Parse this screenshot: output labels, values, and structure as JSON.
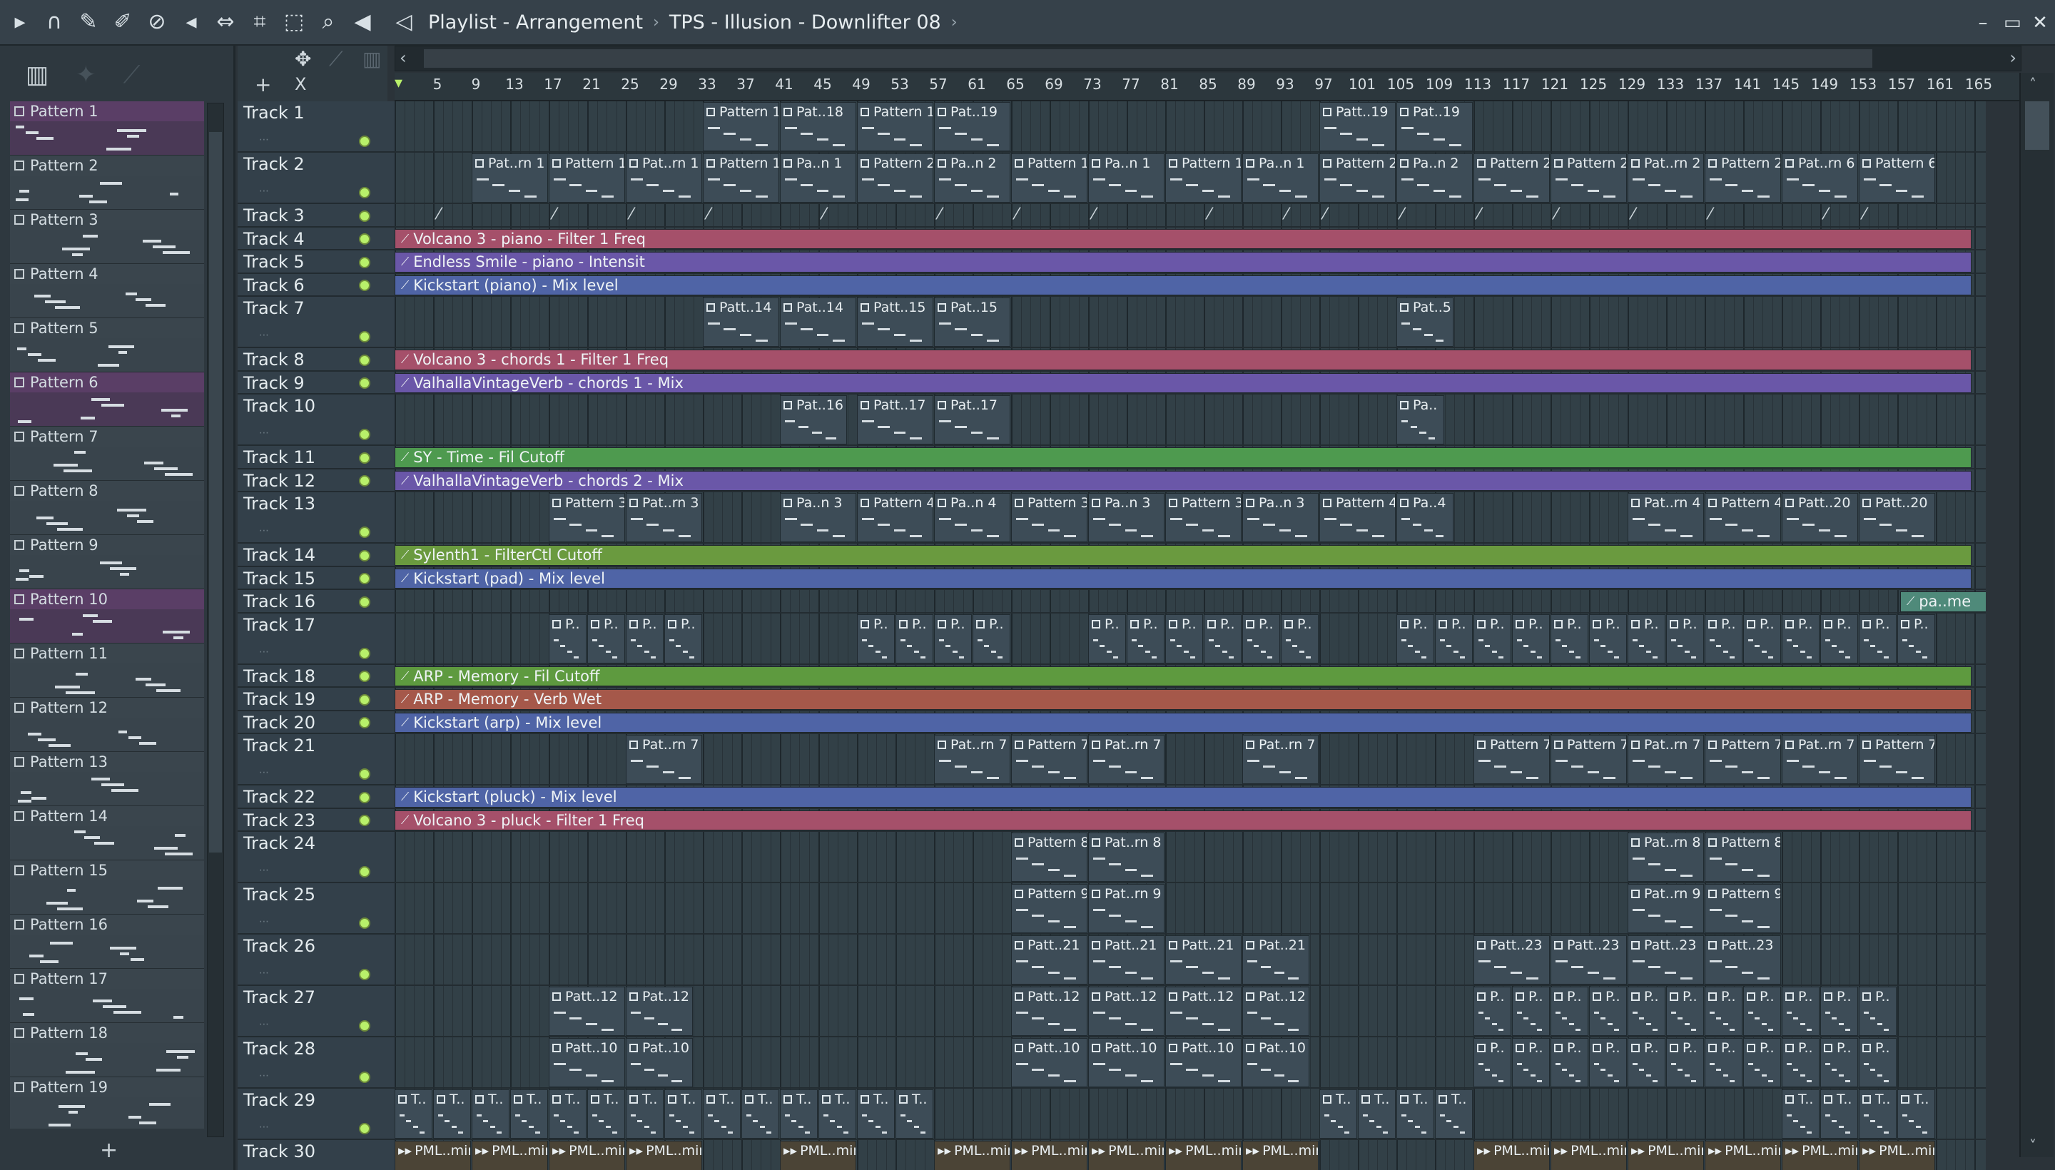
{
  "titlebar": {
    "icons": [
      "play-arrow-icon",
      "magnet-icon",
      "pencil-icon",
      "brush-icon",
      "delete-icon",
      "mute-icon",
      "slip-icon",
      "slice-icon",
      "select-icon",
      "zoom-icon",
      "playback-icon"
    ],
    "window_name": "Playlist - Arrangement",
    "sep1": "›",
    "project": "TPS - Illusion - Downlifter 08",
    "sep2": "›",
    "controls": [
      "minimize-icon",
      "maximize-icon",
      "close-icon"
    ]
  },
  "picker": {
    "tools": [
      "pattern-picker-icon",
      "audio-picker-icon",
      "automation-picker-icon"
    ],
    "add_label": "+",
    "patterns": [
      {
        "label": "Pattern 1",
        "selected": true
      },
      {
        "label": "Pattern 2",
        "selected": false
      },
      {
        "label": "Pattern 3",
        "selected": false
      },
      {
        "label": "Pattern 4",
        "selected": false
      },
      {
        "label": "Pattern 5",
        "selected": false
      },
      {
        "label": "Pattern 6",
        "selected": true
      },
      {
        "label": "Pattern 7",
        "selected": false
      },
      {
        "label": "Pattern 8",
        "selected": false
      },
      {
        "label": "Pattern 9",
        "selected": false
      },
      {
        "label": "Pattern 10",
        "selected": true
      },
      {
        "label": "Pattern 11",
        "selected": false
      },
      {
        "label": "Pattern 12",
        "selected": false
      },
      {
        "label": "Pattern 13",
        "selected": false
      },
      {
        "label": "Pattern 14",
        "selected": false
      },
      {
        "label": "Pattern 15",
        "selected": false
      },
      {
        "label": "Pattern 16",
        "selected": false
      },
      {
        "label": "Pattern 17",
        "selected": false
      },
      {
        "label": "Pattern 18",
        "selected": false
      },
      {
        "label": "Pattern 19",
        "selected": false
      }
    ]
  },
  "toolstrip": {
    "add_track": "+",
    "delete": "X"
  },
  "ruler": {
    "ticks": [
      "5",
      "9",
      "13",
      "17",
      "21",
      "25",
      "29",
      "33",
      "37",
      "41",
      "45",
      "49",
      "53",
      "57",
      "61",
      "65",
      "69",
      "73",
      "77",
      "81",
      "85",
      "89",
      "93",
      "97",
      "101",
      "105",
      "109",
      "113",
      "117",
      "121",
      "125",
      "129",
      "133",
      "137",
      "141",
      "145",
      "149",
      "153",
      "157",
      "161",
      "165"
    ]
  },
  "tracks": [
    {
      "name": "Track 1",
      "tall": true
    },
    {
      "name": "Track 2",
      "tall": true
    },
    {
      "name": "Track 3",
      "tall": false
    },
    {
      "name": "Track 4",
      "tall": false
    },
    {
      "name": "Track 5",
      "tall": false
    },
    {
      "name": "Track 6",
      "tall": false
    },
    {
      "name": "Track 7",
      "tall": true
    },
    {
      "name": "Track 8",
      "tall": false
    },
    {
      "name": "Track 9",
      "tall": false
    },
    {
      "name": "Track 10",
      "tall": true
    },
    {
      "name": "Track 11",
      "tall": false
    },
    {
      "name": "Track 12",
      "tall": false
    },
    {
      "name": "Track 13",
      "tall": true
    },
    {
      "name": "Track 14",
      "tall": false
    },
    {
      "name": "Track 15",
      "tall": false
    },
    {
      "name": "Track 16",
      "tall": false
    },
    {
      "name": "Track 17",
      "tall": true
    },
    {
      "name": "Track 18",
      "tall": false
    },
    {
      "name": "Track 19",
      "tall": false
    },
    {
      "name": "Track 20",
      "tall": false
    },
    {
      "name": "Track 21",
      "tall": true
    },
    {
      "name": "Track 22",
      "tall": false
    },
    {
      "name": "Track 23",
      "tall": false
    },
    {
      "name": "Track 24",
      "tall": true
    },
    {
      "name": "Track 25",
      "tall": true
    },
    {
      "name": "Track 26",
      "tall": true
    },
    {
      "name": "Track 27",
      "tall": true
    },
    {
      "name": "Track 28",
      "tall": true
    },
    {
      "name": "Track 29",
      "tall": true
    },
    {
      "name": "Track 30",
      "tall": true
    }
  ],
  "automation": [
    {
      "track": 3,
      "label": "Volcano 3 - piano - Filter 1 Freq",
      "color": "#a5506a"
    },
    {
      "track": 4,
      "label": "Endless Smile - piano - Intensit",
      "color": "#6a57a8"
    },
    {
      "track": 5,
      "label": "Kickstart (piano) - Mix level",
      "color": "#4f64a6"
    },
    {
      "track": 7,
      "label": "Volcano 3 - chords 1 - Filter 1 Freq",
      "color": "#a5506a"
    },
    {
      "track": 8,
      "label": "ValhallaVintageVerb - chords 1 - Mix",
      "color": "#6a57a8"
    },
    {
      "track": 10,
      "label": "SY - Time - Fil Cutoff",
      "color": "#4e9a4f"
    },
    {
      "track": 11,
      "label": "ValhallaVintageVerb - chords 2 - Mix",
      "color": "#6a57a8"
    },
    {
      "track": 13,
      "label": "Sylenth1 - FilterCtl Cutoff",
      "color": "#6a9a3f"
    },
    {
      "track": 14,
      "label": "Kickstart (pad) - Mix level",
      "color": "#4f64a6"
    },
    {
      "track": 17,
      "label": "ARP - Memory - Fil Cutoff",
      "color": "#5e9a3f"
    },
    {
      "track": 18,
      "label": "ARP - Memory - Verb Wet",
      "color": "#a5584a"
    },
    {
      "track": 19,
      "label": "Kickstart (arp) - Mix level",
      "color": "#4f64a6"
    },
    {
      "track": 21,
      "label": "Kickstart (pluck) - Mix level",
      "color": "#4f64a6"
    },
    {
      "track": 22,
      "label": "Volcano 3 - pluck - Filter 1 Freq",
      "color": "#a5506a"
    }
  ],
  "track16_clip": "pa..me",
  "clips": [
    {
      "track": 0,
      "bar": 33,
      "len": 8,
      "label": "Pattern 1"
    },
    {
      "track": 0,
      "bar": 41,
      "len": 8,
      "label": "Pat..18"
    },
    {
      "track": 0,
      "bar": 49,
      "len": 8,
      "label": "Pattern 1"
    },
    {
      "track": 0,
      "bar": 57,
      "len": 8,
      "label": "Pat..19"
    },
    {
      "track": 0,
      "bar": 97,
      "len": 8,
      "label": "Patt..19"
    },
    {
      "track": 0,
      "bar": 105,
      "len": 8,
      "label": "Pat..19"
    },
    {
      "track": 1,
      "bar": 9,
      "len": 8,
      "label": "Pat..rn 1"
    },
    {
      "track": 1,
      "bar": 17,
      "len": 8,
      "label": "Pattern 1"
    },
    {
      "track": 1,
      "bar": 25,
      "len": 8,
      "label": "Pat..rn 1"
    },
    {
      "track": 1,
      "bar": 33,
      "len": 8,
      "label": "Pattern 1"
    },
    {
      "track": 1,
      "bar": 41,
      "len": 8,
      "label": "Pa..n 1"
    },
    {
      "track": 1,
      "bar": 49,
      "len": 8,
      "label": "Pattern 2"
    },
    {
      "track": 1,
      "bar": 57,
      "len": 8,
      "label": "Pa..n 2"
    },
    {
      "track": 1,
      "bar": 65,
      "len": 8,
      "label": "Pattern 1"
    },
    {
      "track": 1,
      "bar": 73,
      "len": 8,
      "label": "Pa..n 1"
    },
    {
      "track": 1,
      "bar": 81,
      "len": 8,
      "label": "Pattern 1"
    },
    {
      "track": 1,
      "bar": 89,
      "len": 8,
      "label": "Pa..n 1"
    },
    {
      "track": 1,
      "bar": 97,
      "len": 8,
      "label": "Pattern 2"
    },
    {
      "track": 1,
      "bar": 105,
      "len": 8,
      "label": "Pa..n 2"
    },
    {
      "track": 1,
      "bar": 113,
      "len": 8,
      "label": "Pattern 2"
    },
    {
      "track": 1,
      "bar": 121,
      "len": 8,
      "label": "Pattern 2"
    },
    {
      "track": 1,
      "bar": 129,
      "len": 8,
      "label": "Pat..rn 2"
    },
    {
      "track": 1,
      "bar": 137,
      "len": 8,
      "label": "Pattern 2"
    },
    {
      "track": 1,
      "bar": 145,
      "len": 8,
      "label": "Pat..rn 6"
    },
    {
      "track": 1,
      "bar": 153,
      "len": 8,
      "label": "Pattern 6"
    },
    {
      "track": 6,
      "bar": 33,
      "len": 8,
      "label": "Patt..14"
    },
    {
      "track": 6,
      "bar": 41,
      "len": 8,
      "label": "Pat..14"
    },
    {
      "track": 6,
      "bar": 49,
      "len": 8,
      "label": "Patt..15"
    },
    {
      "track": 6,
      "bar": 57,
      "len": 8,
      "label": "Pat..15"
    },
    {
      "track": 6,
      "bar": 105,
      "len": 6,
      "label": "Pat..5"
    },
    {
      "track": 9,
      "bar": 41,
      "len": 7,
      "label": "Pat..16"
    },
    {
      "track": 9,
      "bar": 49,
      "len": 8,
      "label": "Patt..17"
    },
    {
      "track": 9,
      "bar": 57,
      "len": 8,
      "label": "Pat..17"
    },
    {
      "track": 9,
      "bar": 105,
      "len": 5,
      "label": "Pa.."
    },
    {
      "track": 12,
      "bar": 17,
      "len": 8,
      "label": "Pattern 3"
    },
    {
      "track": 12,
      "bar": 25,
      "len": 8,
      "label": "Pat..rn 3"
    },
    {
      "track": 12,
      "bar": 41,
      "len": 8,
      "label": "Pa..n 3"
    },
    {
      "track": 12,
      "bar": 49,
      "len": 8,
      "label": "Pattern 4"
    },
    {
      "track": 12,
      "bar": 57,
      "len": 8,
      "label": "Pa..n 4"
    },
    {
      "track": 12,
      "bar": 65,
      "len": 8,
      "label": "Pattern 3"
    },
    {
      "track": 12,
      "bar": 73,
      "len": 8,
      "label": "Pa..n 3"
    },
    {
      "track": 12,
      "bar": 81,
      "len": 8,
      "label": "Pattern 3"
    },
    {
      "track": 12,
      "bar": 89,
      "len": 8,
      "label": "Pa..n 3"
    },
    {
      "track": 12,
      "bar": 97,
      "len": 8,
      "label": "Pattern 4"
    },
    {
      "track": 12,
      "bar": 105,
      "len": 6,
      "label": "Pa..4"
    },
    {
      "track": 12,
      "bar": 129,
      "len": 8,
      "label": "Pat..rn 4"
    },
    {
      "track": 12,
      "bar": 137,
      "len": 8,
      "label": "Pattern 4"
    },
    {
      "track": 12,
      "bar": 145,
      "len": 8,
      "label": "Patt..20"
    },
    {
      "track": 12,
      "bar": 153,
      "len": 8,
      "label": "Patt..20"
    },
    {
      "track": 20,
      "bar": 25,
      "len": 8,
      "label": "Pat..rn 7"
    },
    {
      "track": 20,
      "bar": 57,
      "len": 8,
      "label": "Pat..rn 7"
    },
    {
      "track": 20,
      "bar": 65,
      "len": 8,
      "label": "Pattern 7"
    },
    {
      "track": 20,
      "bar": 73,
      "len": 8,
      "label": "Pat..rn 7"
    },
    {
      "track": 20,
      "bar": 89,
      "len": 8,
      "label": "Pat..rn 7"
    },
    {
      "track": 20,
      "bar": 113,
      "len": 8,
      "label": "Pattern 7"
    },
    {
      "track": 20,
      "bar": 121,
      "len": 8,
      "label": "Pattern 7"
    },
    {
      "track": 20,
      "bar": 129,
      "len": 8,
      "label": "Pat..rn 7"
    },
    {
      "track": 20,
      "bar": 137,
      "len": 8,
      "label": "Pattern 7"
    },
    {
      "track": 20,
      "bar": 145,
      "len": 8,
      "label": "Pat..rn 7"
    },
    {
      "track": 20,
      "bar": 153,
      "len": 8,
      "label": "Pattern 7"
    },
    {
      "track": 23,
      "bar": 65,
      "len": 8,
      "label": "Pattern 8"
    },
    {
      "track": 23,
      "bar": 73,
      "len": 8,
      "label": "Pat..rn 8"
    },
    {
      "track": 23,
      "bar": 129,
      "len": 8,
      "label": "Pat..rn 8"
    },
    {
      "track": 23,
      "bar": 137,
      "len": 8,
      "label": "Pattern 8"
    },
    {
      "track": 24,
      "bar": 65,
      "len": 8,
      "label": "Pattern 9"
    },
    {
      "track": 24,
      "bar": 73,
      "len": 8,
      "label": "Pat..rn 9"
    },
    {
      "track": 24,
      "bar": 129,
      "len": 8,
      "label": "Pat..rn 9"
    },
    {
      "track": 24,
      "bar": 137,
      "len": 8,
      "label": "Pattern 9"
    },
    {
      "track": 25,
      "bar": 65,
      "len": 8,
      "label": "Patt..21"
    },
    {
      "track": 25,
      "bar": 73,
      "len": 8,
      "label": "Patt..21"
    },
    {
      "track": 25,
      "bar": 81,
      "len": 8,
      "label": "Patt..21"
    },
    {
      "track": 25,
      "bar": 89,
      "len": 7,
      "label": "Pat..21"
    },
    {
      "track": 25,
      "bar": 113,
      "len": 8,
      "label": "Patt..23"
    },
    {
      "track": 25,
      "bar": 121,
      "len": 8,
      "label": "Patt..23"
    },
    {
      "track": 25,
      "bar": 129,
      "len": 8,
      "label": "Patt..23"
    },
    {
      "track": 25,
      "bar": 137,
      "len": 8,
      "label": "Patt..23"
    },
    {
      "track": 26,
      "bar": 17,
      "len": 8,
      "label": "Patt..12"
    },
    {
      "track": 26,
      "bar": 25,
      "len": 7,
      "label": "Pat..12"
    },
    {
      "track": 26,
      "bar": 65,
      "len": 8,
      "label": "Patt..12"
    },
    {
      "track": 26,
      "bar": 73,
      "len": 8,
      "label": "Patt..12"
    },
    {
      "track": 26,
      "bar": 81,
      "len": 8,
      "label": "Patt..12"
    },
    {
      "track": 26,
      "bar": 89,
      "len": 7,
      "label": "Pat..12"
    },
    {
      "track": 27,
      "bar": 17,
      "len": 8,
      "label": "Patt..10"
    },
    {
      "track": 27,
      "bar": 25,
      "len": 7,
      "label": "Pat..10"
    },
    {
      "track": 27,
      "bar": 65,
      "len": 8,
      "label": "Patt..10"
    },
    {
      "track": 27,
      "bar": 73,
      "len": 8,
      "label": "Patt..10"
    },
    {
      "track": 27,
      "bar": 81,
      "len": 8,
      "label": "Patt..10"
    },
    {
      "track": 27,
      "bar": 89,
      "len": 7,
      "label": "Pat..10"
    }
  ],
  "small_clips": [
    {
      "track": 16,
      "bars": [
        17,
        21,
        25,
        29,
        49,
        53,
        57,
        61,
        73,
        77,
        81,
        85,
        89,
        93,
        105,
        109,
        113,
        117,
        121,
        125,
        129,
        133,
        137,
        141,
        145,
        149,
        153,
        157
      ],
      "label": "P.."
    },
    {
      "track": 26,
      "bars": [
        113,
        117,
        121,
        125,
        129,
        133,
        137,
        141,
        145,
        149,
        153
      ],
      "label": "P.."
    },
    {
      "track": 27,
      "bars": [
        113,
        117,
        121,
        125,
        129,
        133,
        137,
        141,
        145,
        149,
        153
      ],
      "label": "P.."
    },
    {
      "track": 28,
      "bars": [
        1,
        5,
        9,
        13,
        17,
        21,
        25,
        29,
        33,
        37,
        41,
        45,
        49,
        53,
        97,
        101,
        105,
        109,
        145,
        149,
        153,
        157
      ],
      "label": "T.."
    }
  ],
  "pml_clips": {
    "track": 29,
    "bars": [
      1,
      9,
      17,
      25,
      41,
      57,
      65,
      73,
      81,
      89,
      113,
      121,
      129,
      137,
      145,
      153
    ],
    "label": "PML..min"
  }
}
